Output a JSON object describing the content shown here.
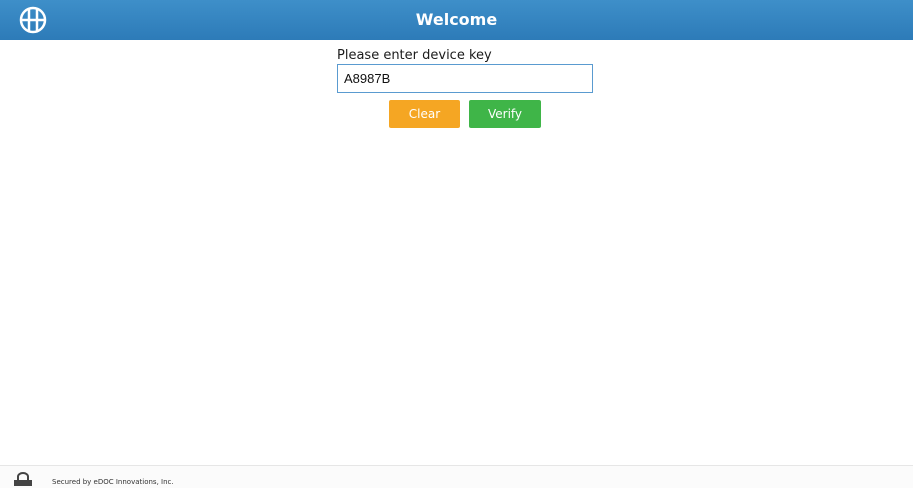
{
  "header": {
    "logo_icon": "globe-logo-icon",
    "title": "Welcome",
    "background_color": "#2d7bb8"
  },
  "device_key": {
    "label": "Please enter device key",
    "value": "A8987B"
  },
  "buttons": {
    "clear_label": "Clear",
    "clear_color": "#f5a623",
    "verify_label": "Verify",
    "verify_color": "#3fb548"
  },
  "footer": {
    "lock_icon": "lock-icon",
    "text": "Secured by eDOC Innovations, Inc."
  }
}
